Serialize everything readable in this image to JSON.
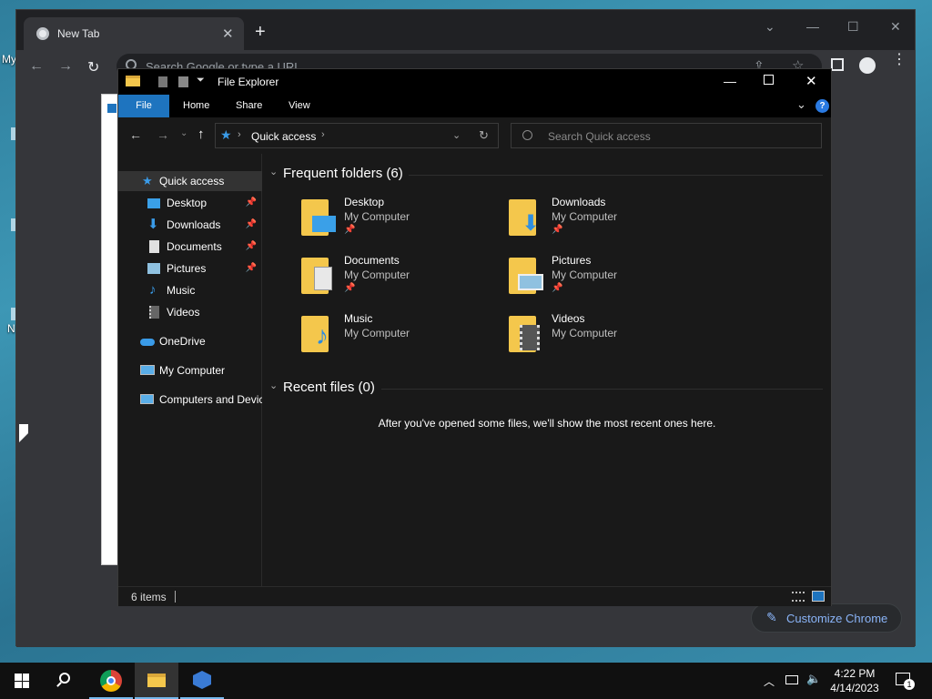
{
  "desktop": {
    "icon_label_my": "My",
    "icon_label_n": "N"
  },
  "chrome": {
    "tab_title": "New Tab",
    "new_tab_symbol": "+",
    "omnibox_placeholder": "Search Google or type a URL",
    "customize_label": "Customize Chrome"
  },
  "explorer": {
    "title": "File Explorer",
    "ribbon_tabs": [
      "File",
      "Home",
      "Share",
      "View"
    ],
    "address_location": "Quick access",
    "search_placeholder": "Search Quick access",
    "nav": [
      {
        "label": "Quick access",
        "icon": "star-icon",
        "pinned": false
      },
      {
        "label": "Desktop",
        "icon": "desktop-icon",
        "pinned": true
      },
      {
        "label": "Downloads",
        "icon": "download-arrow-icon",
        "pinned": true
      },
      {
        "label": "Documents",
        "icon": "document-icon",
        "pinned": true
      },
      {
        "label": "Pictures",
        "icon": "picture-icon",
        "pinned": true
      },
      {
        "label": "Music",
        "icon": "music-note-icon",
        "pinned": false
      },
      {
        "label": "Videos",
        "icon": "film-icon",
        "pinned": false
      },
      {
        "label": "OneDrive",
        "icon": "cloud-icon",
        "pinned": false
      },
      {
        "label": "My Computer",
        "icon": "monitor-icon",
        "pinned": false
      },
      {
        "label": "Computers and Devices",
        "icon": "network-icon",
        "pinned": false
      }
    ],
    "frequent_header": "Frequent folders (6)",
    "folders": [
      {
        "name": "Desktop",
        "location": "My Computer",
        "pinned": true,
        "overlay_color": "#3aa0e8"
      },
      {
        "name": "Downloads",
        "location": "My Computer",
        "pinned": true,
        "overlay_color": "#2f8fe0"
      },
      {
        "name": "Documents",
        "location": "My Computer",
        "pinned": true,
        "overlay_color": "#e8e8e8"
      },
      {
        "name": "Pictures",
        "location": "My Computer",
        "pinned": true,
        "overlay_color": "#8fc1e0"
      },
      {
        "name": "Music",
        "location": "My Computer",
        "pinned": false,
        "overlay_color": "#2b8ae0"
      },
      {
        "name": "Videos",
        "location": "My Computer",
        "pinned": false,
        "overlay_color": "#555555"
      }
    ],
    "recent_header": "Recent files (0)",
    "recent_empty": "After you've opened some files, we'll show the most recent ones here.",
    "status_items": "6 items"
  },
  "taskbar": {
    "time": "4:22 PM",
    "date": "4/14/2023",
    "notification_count": "1"
  },
  "colors": {
    "accent_file_tab": "#1e74bf",
    "folder_yellow": "#f4c74c",
    "help_blue": "#2a7ae2"
  }
}
